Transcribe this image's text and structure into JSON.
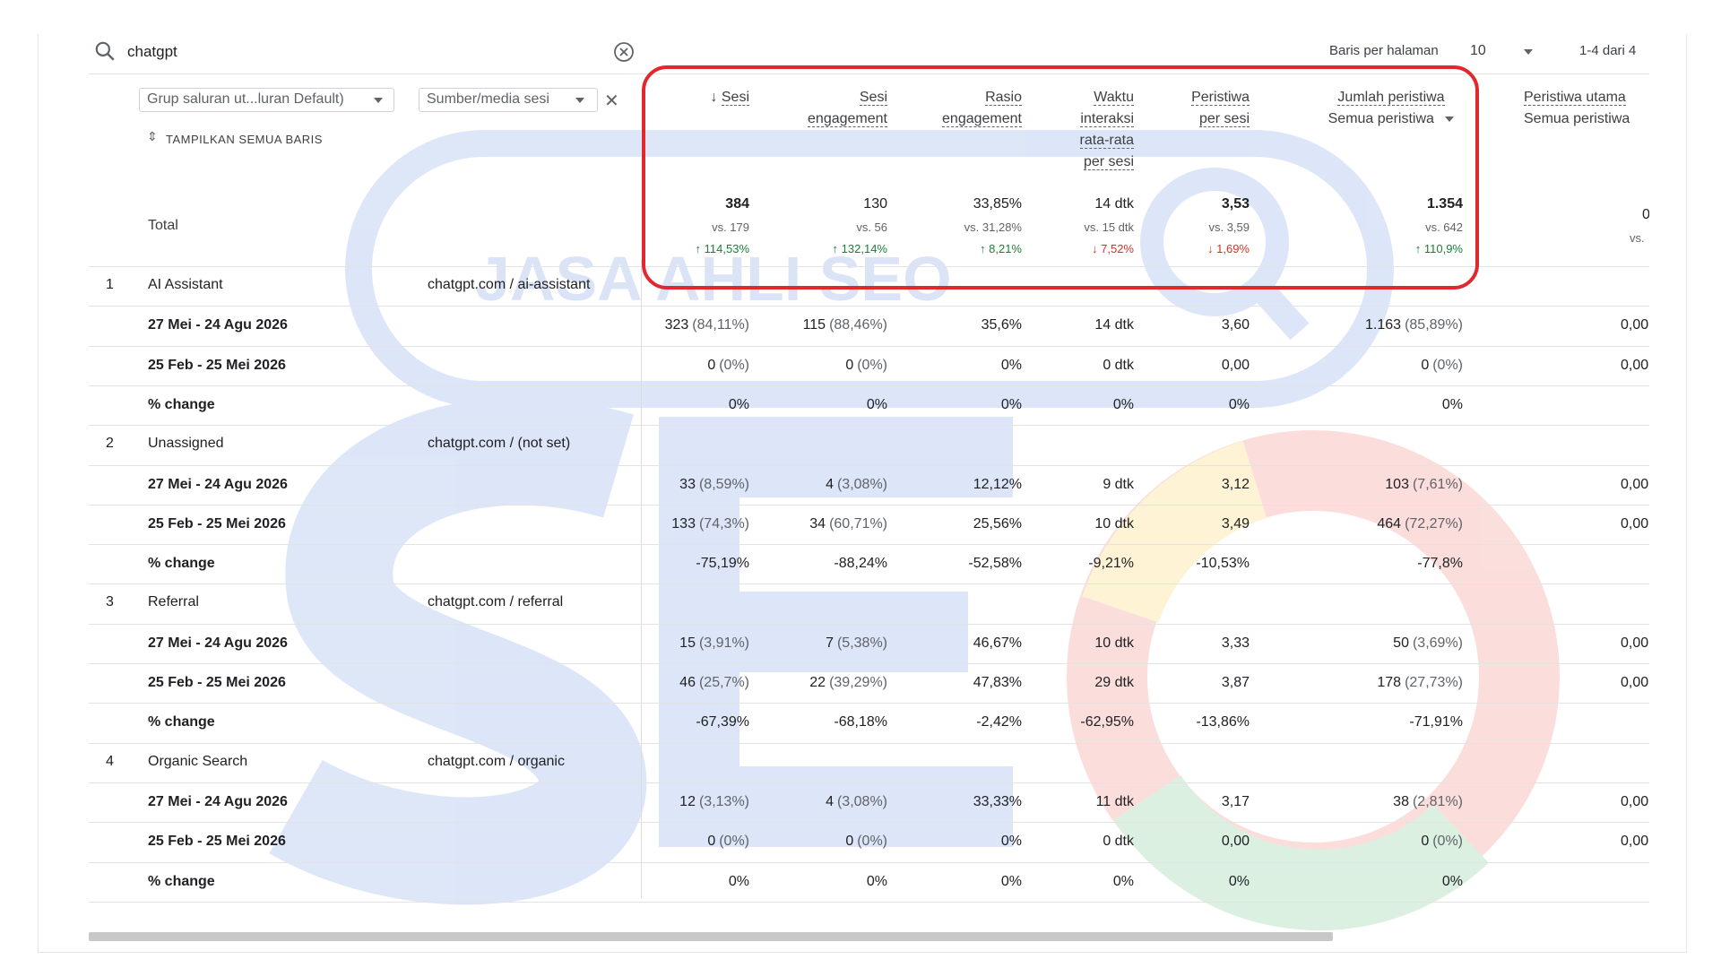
{
  "search": {
    "value": "chatgpt"
  },
  "pagination": {
    "rows_label": "Baris per halaman",
    "rows_value": "10",
    "range": "1-4 dari 4"
  },
  "dimensions": {
    "primary_dropdown": "Grup saluran ut...luran Default)",
    "secondary_dropdown": "Sumber/media sesi",
    "show_all_rows": "TAMPILKAN SEMUA BARIS"
  },
  "columns": {
    "sesi": "Sesi",
    "sesi_engagement_1": "Sesi",
    "sesi_engagement_2": "engagement",
    "rasio_1": "Rasio",
    "rasio_2": "engagement",
    "waktu_1": "Waktu",
    "waktu_2": "interaksi",
    "waktu_3": "rata-rata",
    "waktu_4": "per sesi",
    "peristiwa_1": "Peristiwa",
    "peristiwa_2": "per sesi",
    "jumlah_1": "Jumlah peristiwa",
    "jumlah_2": "Semua peristiwa",
    "utama_1": "Peristiwa utama",
    "utama_2": "Semua peristiwa"
  },
  "totals": {
    "label": "Total",
    "sesi": {
      "value": "384",
      "vs": "vs. 179",
      "change": "114,53%"
    },
    "engagement": {
      "value": "130",
      "vs": "vs. 56",
      "change": "132,14%"
    },
    "rasio": {
      "value": "33,85%",
      "vs": "vs. 31,28%",
      "change": "8,21%"
    },
    "waktu": {
      "value": "14 dtk",
      "vs": "vs. 15 dtk",
      "change": "7,52%"
    },
    "peristiwa": {
      "value": "3,53",
      "vs": "vs. 3,59",
      "change": "1,69%"
    },
    "jumlah": {
      "value": "1.354",
      "vs": "vs. 642",
      "change": "110,9%"
    },
    "utama": {
      "value": "0",
      "vs": "vs."
    }
  },
  "groups": [
    {
      "index": "1",
      "channel": "AI Assistant",
      "source": "chatgpt.com / ai-assistant",
      "rows": [
        {
          "label": "27 Mei - 24 Agu 2026",
          "sesi": "323",
          "sesi_pct": "(84,11%)",
          "eng": "115",
          "eng_pct": "(88,46%)",
          "rasio": "35,6%",
          "waktu": "14 dtk",
          "per": "3,60",
          "jumlah": "1.163",
          "jumlah_pct": "(85,89%)",
          "utama": "0,00"
        },
        {
          "label": "25 Feb - 25 Mei 2026",
          "sesi": "0",
          "sesi_pct": "(0%)",
          "eng": "0",
          "eng_pct": "(0%)",
          "rasio": "0%",
          "waktu": "0 dtk",
          "per": "0,00",
          "jumlah": "0",
          "jumlah_pct": "(0%)",
          "utama": "0,00"
        },
        {
          "label": "% change",
          "sesi": "0%",
          "sesi_pct": "",
          "eng": "0%",
          "eng_pct": "",
          "rasio": "0%",
          "waktu": "0%",
          "per": "0%",
          "jumlah": "0%",
          "jumlah_pct": "",
          "utama": ""
        }
      ]
    },
    {
      "index": "2",
      "channel": "Unassigned",
      "source": "chatgpt.com / (not set)",
      "rows": [
        {
          "label": "27 Mei - 24 Agu 2026",
          "sesi": "33",
          "sesi_pct": "(8,59%)",
          "eng": "4",
          "eng_pct": "(3,08%)",
          "rasio": "12,12%",
          "waktu": "9 dtk",
          "per": "3,12",
          "jumlah": "103",
          "jumlah_pct": "(7,61%)",
          "utama": "0,00"
        },
        {
          "label": "25 Feb - 25 Mei 2026",
          "sesi": "133",
          "sesi_pct": "(74,3%)",
          "eng": "34",
          "eng_pct": "(60,71%)",
          "rasio": "25,56%",
          "waktu": "10 dtk",
          "per": "3,49",
          "jumlah": "464",
          "jumlah_pct": "(72,27%)",
          "utama": "0,00"
        },
        {
          "label": "% change",
          "sesi": "-75,19%",
          "sesi_pct": "",
          "eng": "-88,24%",
          "eng_pct": "",
          "rasio": "-52,58%",
          "waktu": "-9,21%",
          "per": "-10,53%",
          "jumlah": "-77,8%",
          "jumlah_pct": "",
          "utama": ""
        }
      ]
    },
    {
      "index": "3",
      "channel": "Referral",
      "source": "chatgpt.com / referral",
      "rows": [
        {
          "label": "27 Mei - 24 Agu 2026",
          "sesi": "15",
          "sesi_pct": "(3,91%)",
          "eng": "7",
          "eng_pct": "(5,38%)",
          "rasio": "46,67%",
          "waktu": "10 dtk",
          "per": "3,33",
          "jumlah": "50",
          "jumlah_pct": "(3,69%)",
          "utama": "0,00"
        },
        {
          "label": "25 Feb - 25 Mei 2026",
          "sesi": "46",
          "sesi_pct": "(25,7%)",
          "eng": "22",
          "eng_pct": "(39,29%)",
          "rasio": "47,83%",
          "waktu": "29 dtk",
          "per": "3,87",
          "jumlah": "178",
          "jumlah_pct": "(27,73%)",
          "utama": "0,00"
        },
        {
          "label": "% change",
          "sesi": "-67,39%",
          "sesi_pct": "",
          "eng": "-68,18%",
          "eng_pct": "",
          "rasio": "-2,42%",
          "waktu": "-62,95%",
          "per": "-13,86%",
          "jumlah": "-71,91%",
          "jumlah_pct": "",
          "utama": ""
        }
      ]
    },
    {
      "index": "4",
      "channel": "Organic Search",
      "source": "chatgpt.com / organic",
      "rows": [
        {
          "label": "27 Mei - 24 Agu 2026",
          "sesi": "12",
          "sesi_pct": "(3,13%)",
          "eng": "4",
          "eng_pct": "(3,08%)",
          "rasio": "33,33%",
          "waktu": "11 dtk",
          "per": "3,17",
          "jumlah": "38",
          "jumlah_pct": "(2,81%)",
          "utama": "0,00"
        },
        {
          "label": "25 Feb - 25 Mei 2026",
          "sesi": "0",
          "sesi_pct": "(0%)",
          "eng": "0",
          "eng_pct": "(0%)",
          "rasio": "0%",
          "waktu": "0 dtk",
          "per": "0,00",
          "jumlah": "0",
          "jumlah_pct": "(0%)",
          "utama": "0,00"
        },
        {
          "label": "% change",
          "sesi": "0%",
          "sesi_pct": "",
          "eng": "0%",
          "eng_pct": "",
          "rasio": "0%",
          "waktu": "0%",
          "per": "0%",
          "jumlah": "0%",
          "jumlah_pct": "",
          "utama": ""
        }
      ]
    }
  ],
  "watermark": {
    "text": "JASA AHLI SEO"
  },
  "colors": {
    "accent": "#1a73e8",
    "highlight": "#e0282e",
    "positive": "#188038",
    "negative": "#d93025"
  }
}
